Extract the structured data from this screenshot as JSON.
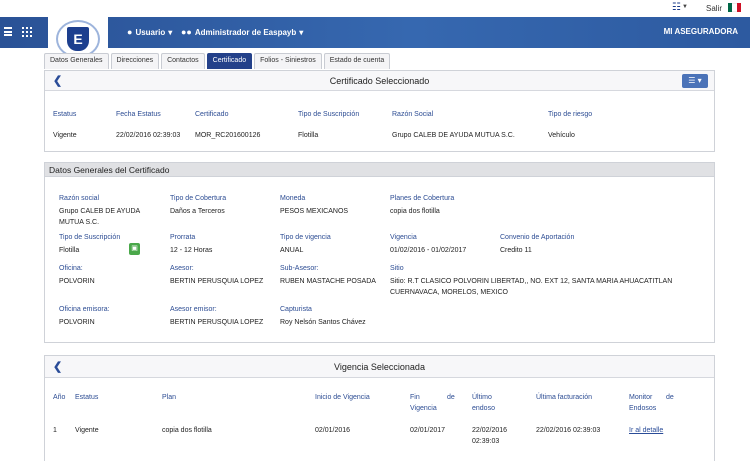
{
  "topbar": {
    "docs_icon": "document-icon",
    "salir": "Salir",
    "flag_colors": [
      "#006847",
      "#ffffff",
      "#ce1126"
    ]
  },
  "nav": {
    "usuario": "Usuario",
    "admin": "Administrador de Easpayb",
    "brand": "MI ASEGURADORA",
    "logo_letter": "E"
  },
  "tabs": [
    {
      "label": "Datos Generales"
    },
    {
      "label": "Direcciones"
    },
    {
      "label": "Contactos"
    },
    {
      "label": "Certificado"
    },
    {
      "label": "Folios - Siniestros"
    },
    {
      "label": "Estado de cuenta"
    }
  ],
  "cert_sel": {
    "title": "Certificado Seleccionado",
    "headers": [
      "Estatus",
      "Fecha Estatus",
      "Certificado",
      "Tipo de Suscripción",
      "Razón Social",
      "Tipo de riesgo"
    ],
    "row": [
      "Vigente",
      "22/02/2016 02:39:03",
      "MOR_RC201600126",
      "Flotilla",
      "Grupo CALEB DE AYUDA MUTUA S.C.",
      "Vehículo"
    ]
  },
  "datos": {
    "title": "Datos Generales del Certificado",
    "razon_social_l": "Razón social",
    "razon_social_v1": "Grupo CALEB DE AYUDA",
    "razon_social_v2": "MUTUA S.C.",
    "tipo_cobertura_l": "Tipo de Cobertura",
    "tipo_cobertura_v": "Daños a Terceros",
    "moneda_l": "Moneda",
    "moneda_v": "PESOS MEXICANOS",
    "planes_l": "Planes de Cobertura",
    "planes_v": "copia dos flotilla",
    "tipo_suscripcion_l": "Tipo de Suscripción",
    "tipo_suscripcion_v": "Flotilla",
    "prorrata_l": "Prorrata",
    "prorrata_v": "12 - 12 Horas",
    "tipo_vigencia_l": "Tipo de vigencia",
    "tipo_vigencia_v": "ANUAL",
    "vigencia_l": "Vigencia",
    "vigencia_v": "01/02/2016 - 01/02/2017",
    "convenio_l": "Convenio de Aportación",
    "convenio_v": "Credito 11",
    "oficina_l": "Oficina:",
    "oficina_v": "POLVORIN",
    "asesor_l": "Asesor:",
    "asesor_v": "BERTIN PERUSQUIA LOPEZ",
    "subasesor_l": "Sub-Asesor:",
    "subasesor_v": "RUBEN MASTACHE POSADA",
    "sitio_l": "Sitio",
    "sitio_v1": "Sitio: R.T CLASICO POLVORIN LIBERTAD,, NO. EXT 12, SANTA MARIA AHUACATITLAN",
    "sitio_v2": "CUERNAVACA, MORELOS, MEXICO",
    "oficina_emisora_l": "Oficina emisora:",
    "oficina_emisora_v": "POLVORIN",
    "asesor_emisor_l": "Asesor emisor:",
    "asesor_emisor_v": "BERTIN PERUSQUIA LOPEZ",
    "capturista_l": "Capturista",
    "capturista_v": "Roy Nelsón Santos Chávez"
  },
  "vig": {
    "title": "Vigencia Seleccionada",
    "h_anio": "Año",
    "h_estatus": "Estatus",
    "h_plan": "Plan",
    "h_inicio": "Inicio de Vigencia",
    "h_fin1": "Fin",
    "h_fin_de": "de",
    "h_fin2": "Vigencia",
    "h_ultimo1": "Último",
    "h_ultimo2": "endoso",
    "h_ultfact": "Última facturación",
    "h_monitor1": "Monitor",
    "h_monitor_de": "de",
    "h_monitor2": "Endosos",
    "r_anio": "1",
    "r_estatus": "Vigente",
    "r_plan": "copia dos flotilla",
    "r_inicio": "02/01/2016",
    "r_fin": "02/01/2017",
    "r_ultimo1": "22/02/2016",
    "r_ultimo2": "02:39:03",
    "r_ultfact": "22/02/2016 02:39:03",
    "r_link": "Ir al detalle"
  }
}
